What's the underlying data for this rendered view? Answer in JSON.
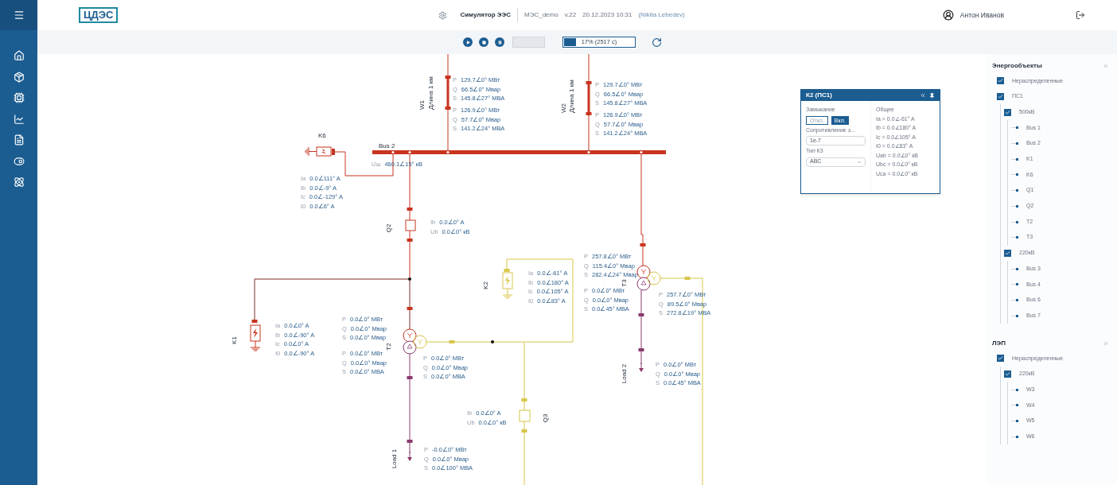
{
  "header": {
    "logo": "ЦДЭС",
    "app_title": "Симулятор ЭЭС",
    "project": "МЭС_demo",
    "version": "v.22",
    "datetime": "20.12.2023 10:31",
    "author": "(Nikita Lebedev)",
    "user": "Антон Иванов"
  },
  "toolbar": {
    "speed_disabled": true,
    "progress": {
      "level": 0.17,
      "label": "17% (2517 с)"
    }
  },
  "diagram": {
    "labels": [
      {
        "text": "K6"
      },
      {
        "text": "Bus 2"
      },
      {
        "text": "W1"
      },
      {
        "text": "Длина 1 км"
      },
      {
        "text": "W2"
      },
      {
        "text": "Длина 1 км"
      },
      {
        "text": "Q2"
      },
      {
        "text": "K2"
      },
      {
        "text": "T3"
      },
      {
        "text": "K1"
      },
      {
        "text": "T2"
      },
      {
        "text": "Load 2"
      },
      {
        "text": "Q3"
      },
      {
        "text": "Load 1"
      }
    ],
    "readings": [
      {
        "rows": [
          {
            "prefix": "P",
            "value": "129.7∠0° МВт"
          },
          {
            "prefix": "Q",
            "value": "66.5∠0° Мвар"
          },
          {
            "prefix": "S",
            "value": "145.8∠27° МВА"
          }
        ]
      },
      {
        "rows": [
          {
            "prefix": "P",
            "value": "126.9∠0° МВт"
          },
          {
            "prefix": "Q",
            "value": "57.7∠0° Мвар"
          },
          {
            "prefix": "S",
            "value": "141.2∠24° МВА"
          }
        ]
      },
      {
        "rows": [
          {
            "prefix": "P",
            "value": "129.7∠0° МВт"
          },
          {
            "prefix": "Q",
            "value": "66.5∠0° Мвар"
          },
          {
            "prefix": "S",
            "value": "145.8∠27° МВА"
          }
        ]
      },
      {
        "rows": [
          {
            "prefix": "P",
            "value": "126.9∠0° МВт"
          },
          {
            "prefix": "Q",
            "value": "57.7∠0° Мвар"
          },
          {
            "prefix": "S",
            "value": "141.2∠24° МВА"
          }
        ]
      },
      {
        "rows": [
          {
            "prefix": "Uш",
            "value": "460.1∠15° кВ"
          }
        ]
      },
      {
        "rows": [
          {
            "prefix": "Ia",
            "value": "0.0∠111° A"
          },
          {
            "prefix": "Ib",
            "value": "0.0∠-9° A"
          },
          {
            "prefix": "Ic",
            "value": "0.0∠-129° A"
          },
          {
            "prefix": "I0",
            "value": "0.0∠6° A"
          }
        ]
      },
      {
        "rows": [
          {
            "prefix": "Ib",
            "value": "0.0∠0° A"
          },
          {
            "prefix": "Ub",
            "value": "0.0∠0° кВ"
          }
        ]
      },
      {
        "rows": [
          {
            "prefix": "Ia",
            "value": "0.0∠-61° A"
          },
          {
            "prefix": "Ib",
            "value": "0.0∠180° A"
          },
          {
            "prefix": "Ic",
            "value": "0.0∠105° A"
          },
          {
            "prefix": "I0",
            "value": "0.0∠83° A"
          }
        ]
      },
      {
        "rows": [
          {
            "prefix": "P",
            "value": "257.8∠0° МВт"
          },
          {
            "prefix": "Q",
            "value": "115.4∠0° Мвар"
          },
          {
            "prefix": "S",
            "value": "282.4∠24° Мвар"
          }
        ]
      },
      {
        "rows": [
          {
            "prefix": "P",
            "value": "0.0∠0° МВт"
          },
          {
            "prefix": "Q",
            "value": "0.0∠0° Мвар"
          },
          {
            "prefix": "S",
            "value": "0.0∠45° МВА"
          }
        ]
      },
      {
        "rows": [
          {
            "prefix": "P",
            "value": "257.7∠0° МВт"
          },
          {
            "prefix": "Q",
            "value": "89.5∠0° Мвар"
          },
          {
            "prefix": "S",
            "value": "272.8∠19° МВА"
          }
        ]
      },
      {
        "rows": [
          {
            "prefix": "Ia",
            "value": "0.0∠0° A"
          },
          {
            "prefix": "Ib",
            "value": "0.0∠-90° A"
          },
          {
            "prefix": "Ic",
            "value": "0.0∠0° A"
          },
          {
            "prefix": "I0",
            "value": "0.0∠-90° A"
          }
        ]
      },
      {
        "rows": [
          {
            "prefix": "P",
            "value": "0.0∠0° МВт"
          },
          {
            "prefix": "Q",
            "value": "0.0∠0° Мвар"
          },
          {
            "prefix": "S",
            "value": "0.0∠0° Мвар"
          }
        ]
      },
      {
        "rows": [
          {
            "prefix": "P",
            "value": "0.0∠0° МВт"
          },
          {
            "prefix": "Q",
            "value": "0.0∠0° Мвар"
          },
          {
            "prefix": "S",
            "value": "0.0∠0° МВА"
          }
        ]
      },
      {
        "rows": [
          {
            "prefix": "P",
            "value": "0.0∠0° МВт"
          },
          {
            "prefix": "Q",
            "value": "0.0∠0° Мвар"
          },
          {
            "prefix": "S",
            "value": "0.0∠0° МВА"
          }
        ]
      },
      {
        "rows": [
          {
            "prefix": "P",
            "value": "0.0∠0° МВт"
          },
          {
            "prefix": "Q",
            "value": "0.0∠0° Мвар"
          },
          {
            "prefix": "S",
            "value": "0.0∠45° МВА"
          }
        ]
      },
      {
        "rows": [
          {
            "prefix": "Ib",
            "value": "0.0∠0° A"
          },
          {
            "prefix": "Ub",
            "value": "0.0∠0° кВ"
          }
        ]
      },
      {
        "rows": [
          {
            "prefix": "P",
            "value": "-0.0∠0° МВт"
          },
          {
            "prefix": "Q",
            "value": "0.0∠0° Мвар"
          },
          {
            "prefix": "S",
            "value": "0.0∠100° МВА"
          }
        ]
      }
    ]
  },
  "popup": {
    "title": "К2 (ПС1)",
    "closure_label": "Замыкание",
    "closure_buttons": [
      {
        "label": "Откл.",
        "selected": false
      },
      {
        "label": "Вкл.",
        "selected": true
      }
    ],
    "resistance_label": "Сопротивление з...",
    "resistance_value": "1e-7",
    "type_label": "Тип КЗ",
    "type_value": "ABC",
    "summary_title": "Общее",
    "summary": [
      "Ia = 0.0∠-61° A",
      "Ib = 0.0∠180° A",
      "Ic = 0.0∠105° A",
      "I0 = 0.0∠83° A",
      "Uab = 0.0∠0° кВ",
      "Ubc = 0.0∠0° кВ",
      "Uca = 0.0∠0° кВ"
    ]
  },
  "tree": {
    "sections": [
      {
        "title": "Энергообъекты",
        "items": [
          {
            "kind": "group",
            "label": "Нераспределенные",
            "checked": true
          },
          {
            "kind": "group",
            "label": "ПС1",
            "checked": true,
            "children": [
              {
                "kind": "group",
                "label": "500кВ",
                "checked": true,
                "children": [
                  {
                    "kind": "leaf",
                    "label": "Bus 1"
                  },
                  {
                    "kind": "leaf",
                    "label": "Bus 2"
                  },
                  {
                    "kind": "leaf",
                    "label": "K1"
                  },
                  {
                    "kind": "leaf",
                    "label": "K6"
                  },
                  {
                    "kind": "leaf",
                    "label": "Q1"
                  },
                  {
                    "kind": "leaf",
                    "label": "Q2"
                  },
                  {
                    "kind": "leaf",
                    "label": "T2"
                  },
                  {
                    "kind": "leaf",
                    "label": "T3"
                  }
                ]
              },
              {
                "kind": "group",
                "label": "220кВ",
                "checked": true,
                "children": [
                  {
                    "kind": "leaf",
                    "label": "Bus 3"
                  },
                  {
                    "kind": "leaf",
                    "label": "Bus 4"
                  },
                  {
                    "kind": "leaf",
                    "label": "Bus 6"
                  },
                  {
                    "kind": "leaf",
                    "label": "Bus 7"
                  }
                ]
              }
            ]
          }
        ]
      },
      {
        "title": "ЛЭП",
        "items": [
          {
            "kind": "group",
            "label": "Нераспределенные",
            "checked": true,
            "children": [
              {
                "kind": "group",
                "label": "220кВ",
                "checked": true,
                "children": [
                  {
                    "kind": "leaf",
                    "label": "W3"
                  },
                  {
                    "kind": "leaf",
                    "label": "W4"
                  },
                  {
                    "kind": "leaf",
                    "label": "W5"
                  },
                  {
                    "kind": "leaf",
                    "label": "W6"
                  }
                ]
              }
            ]
          }
        ]
      }
    ]
  }
}
